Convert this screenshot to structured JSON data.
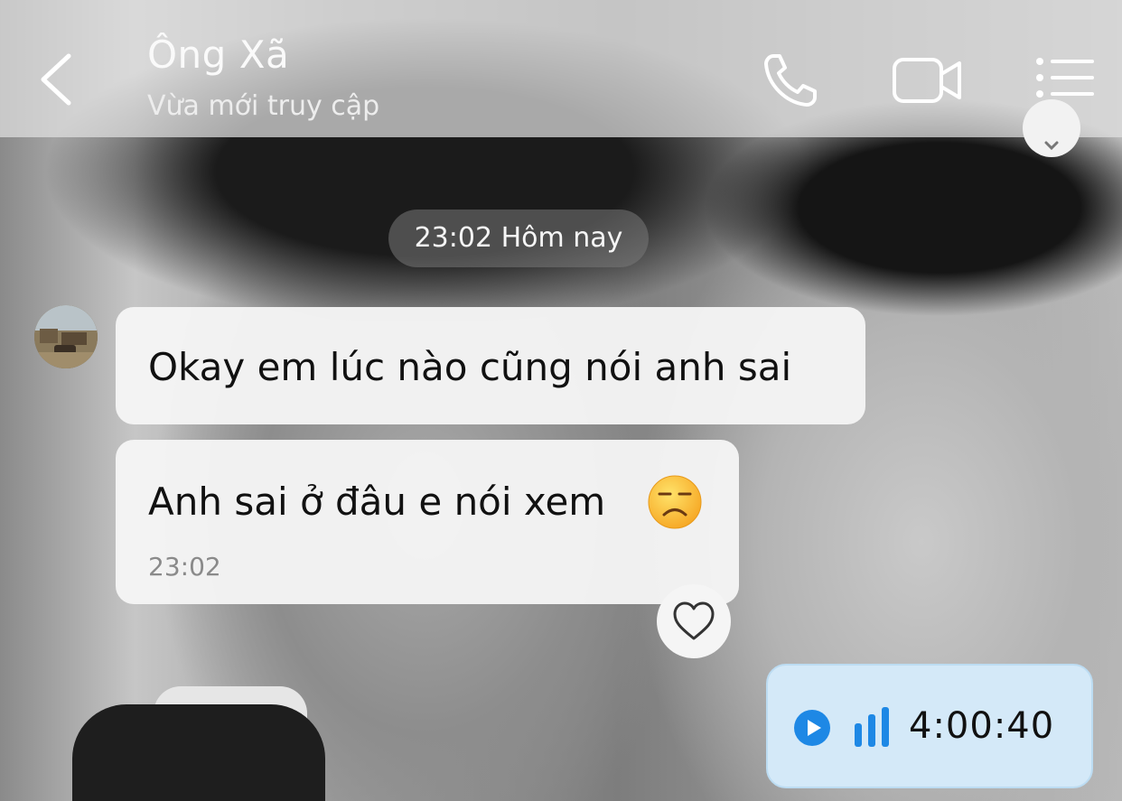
{
  "header": {
    "contact_name": "Ông Xã",
    "status": "Vừa mới truy cập"
  },
  "icons": {
    "back": "chevron-left-icon",
    "call": "phone-icon",
    "video": "video-camera-icon",
    "menu": "list-menu-icon"
  },
  "time_separator": "23:02 Hôm nay",
  "messages": [
    {
      "text": "Okay em lúc nào cũng nói anh sai"
    },
    {
      "text": "Anh sai ở đâu e nói xem",
      "emoji": "unamused-face",
      "time": "23:02"
    }
  ],
  "voice_message": {
    "duration": "4:00:40",
    "accent": "#1e88e5"
  }
}
